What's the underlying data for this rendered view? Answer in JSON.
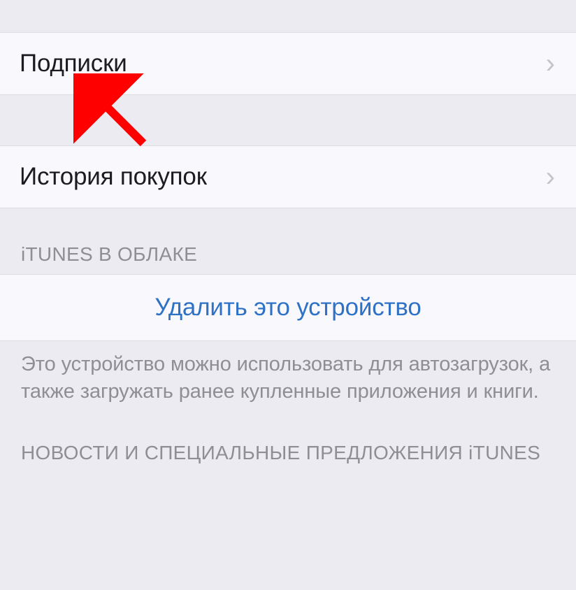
{
  "sections": {
    "subscriptions": {
      "label": "Подписки"
    },
    "purchaseHistory": {
      "label": "История покупок"
    },
    "itunesCloud": {
      "header": "iTUNES В ОБЛАКЕ",
      "removeDevice": "Удалить это устройство",
      "footer": "Это устройство можно использовать для автозагрузок, а также загружать ранее купленные приложения и книги."
    },
    "newsOffers": {
      "header": "НОВОСТИ И СПЕЦИАЛЬНЫЕ ПРЕДЛОЖЕНИЯ iTUNES"
    }
  }
}
